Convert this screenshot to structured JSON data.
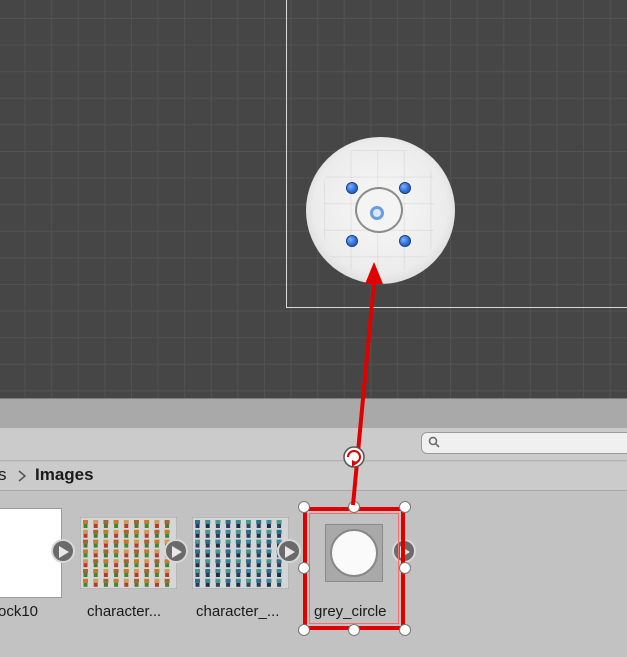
{
  "project_panel": {
    "search": {
      "placeholder": "",
      "icon": "search-icon"
    },
    "breadcrumb": {
      "previous": "s",
      "separator_icon": "chevron-right-icon",
      "current": "Images"
    },
    "assets": [
      {
        "label": "ock10",
        "kind": "white-texture"
      },
      {
        "label": "character...",
        "kind": "sprite-sheet"
      },
      {
        "label": "character_...",
        "kind": "sprite-sheet"
      },
      {
        "label": "grey_circle",
        "kind": "circle-sprite",
        "selected": true
      }
    ]
  },
  "colors": {
    "scene_background": "#464646",
    "selection_red": "#e00000",
    "gizmo_blue": "#2f6fd9"
  }
}
